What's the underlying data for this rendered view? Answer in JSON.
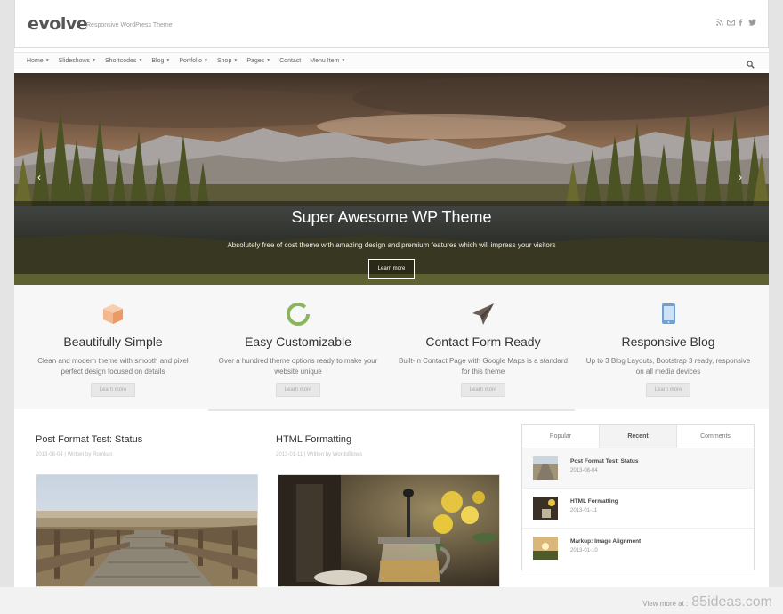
{
  "header": {
    "logo": "evolve",
    "tagline": "Responsive WordPress Theme",
    "social_icons": [
      "rss-icon",
      "email-icon",
      "facebook-icon",
      "twitter-icon"
    ]
  },
  "nav": {
    "items": [
      {
        "label": "Home",
        "has_dropdown": true
      },
      {
        "label": "Slideshows",
        "has_dropdown": true
      },
      {
        "label": "Shortcodes",
        "has_dropdown": true
      },
      {
        "label": "Blog",
        "has_dropdown": true
      },
      {
        "label": "Portfolio",
        "has_dropdown": true
      },
      {
        "label": "Shop",
        "has_dropdown": true
      },
      {
        "label": "Pages",
        "has_dropdown": true
      },
      {
        "label": "Contact",
        "has_dropdown": false
      },
      {
        "label": "Menu Item",
        "has_dropdown": true
      }
    ]
  },
  "slider": {
    "title": "Super Awesome WP Theme",
    "subtitle": "Absolutely free of cost theme with amazing design and premium features which will impress your visitors",
    "button": "Learn more",
    "prev_arrow": "‹",
    "next_arrow": "›"
  },
  "features": [
    {
      "icon": "cube-icon",
      "color": "#f0a878",
      "title": "Beautifully Simple",
      "desc": "Clean and modern theme with smooth and pixel perfect design focused on details",
      "button": "Learn more"
    },
    {
      "icon": "circle-icon",
      "color": "#8bb55d",
      "title": "Easy Customizable",
      "desc": "Over a hundred theme options ready to make your website unique",
      "button": "Learn more"
    },
    {
      "icon": "send-icon",
      "color": "#6b5e58",
      "title": "Contact Form Ready",
      "desc": "Built-In Contact Page with Google Maps is a standard for this theme",
      "button": "Learn more"
    },
    {
      "icon": "tablet-icon",
      "color": "#6ea0d8",
      "title": "Responsive Blog",
      "desc": "Up to 3 Blog Layouts, Bootstrap 3 ready, responsive on all media devices",
      "button": "Learn more"
    }
  ],
  "posts": [
    {
      "title": "Post Format Test: Status",
      "date": "2013-08-04",
      "author_prefix": "Written by",
      "author": "Romkan"
    },
    {
      "title": "HTML Formatting",
      "date": "2013-01-11",
      "author_prefix": "Written by",
      "author": "WordsBlows"
    }
  ],
  "widget": {
    "tabs": [
      {
        "label": "Popular",
        "active": false
      },
      {
        "label": "Recent",
        "active": true
      },
      {
        "label": "Comments",
        "active": false
      }
    ],
    "items": [
      {
        "title": "Post Format Test: Status",
        "date": "2013-08-04"
      },
      {
        "title": "HTML Formatting",
        "date": "2013-01-11"
      },
      {
        "title": "Markup: Image Alignment",
        "date": "2013-01-10"
      }
    ]
  },
  "watermark": {
    "prefix": "View more at :",
    "site": "85ideas.com"
  }
}
